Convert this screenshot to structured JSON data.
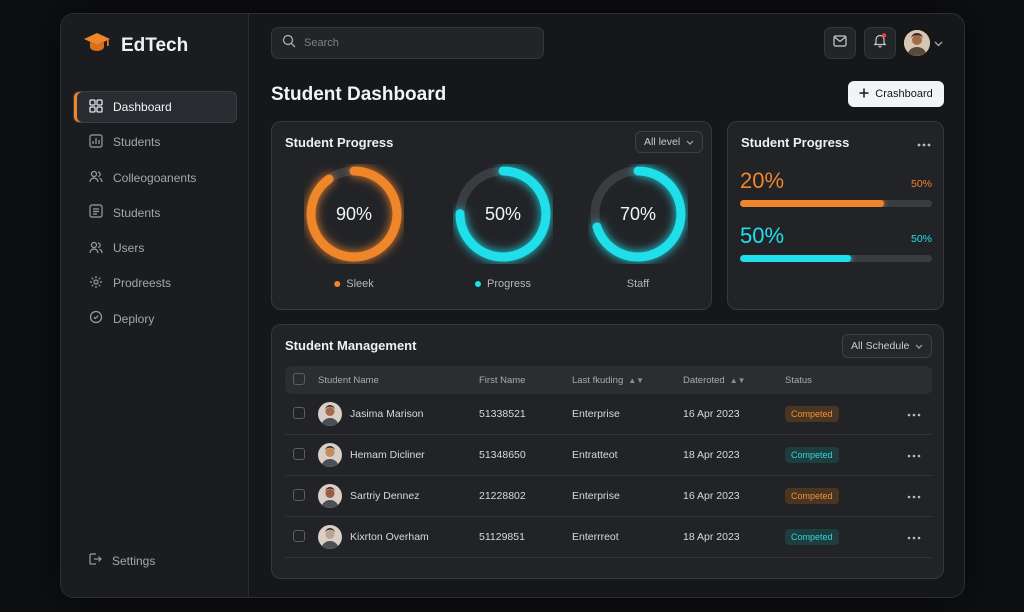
{
  "app": {
    "title": "EdTech"
  },
  "colors": {
    "orange": "#f0862a",
    "cyan": "#1fe0ea",
    "teal": "#3ad3d8",
    "bg": "#161719"
  },
  "sidebar": {
    "items": [
      {
        "label": "Dashboard",
        "icon": "grid-icon",
        "active": true
      },
      {
        "label": "Students",
        "icon": "chart-icon"
      },
      {
        "label": "Colleogoanents",
        "icon": "users-icon"
      },
      {
        "label": "Students",
        "icon": "list-icon"
      },
      {
        "label": "Users",
        "icon": "users-icon"
      },
      {
        "label": "Prodreests",
        "icon": "gear-icon"
      },
      {
        "label": "Deplory",
        "icon": "badge-icon"
      }
    ],
    "settings_label": "Settings"
  },
  "search": {
    "placeholder": "Search"
  },
  "page": {
    "title": "Student Dashboard",
    "primary_button": "Crashboard"
  },
  "progress_card": {
    "title": "Student Progress",
    "filter": "All level",
    "donuts": [
      {
        "value": 90,
        "label": "90%",
        "legend": "Sleek",
        "color": "#f0862a",
        "dot": true
      },
      {
        "value": 75,
        "label": "50%",
        "legend": "Progress",
        "color": "#1fe0ea",
        "dot": true
      },
      {
        "value": 70,
        "label": "70%",
        "legend": "Staff",
        "color": "#1fe0ea",
        "dot": false
      }
    ]
  },
  "progress_bars_card": {
    "title": "Student Progress",
    "bars": [
      {
        "label": "20%",
        "side": "50%",
        "fill": 0.75,
        "color": "#f0862a"
      },
      {
        "label": "50%",
        "side": "50%",
        "fill": 0.58,
        "color": "#1fe0ea"
      }
    ]
  },
  "management": {
    "title": "Student Management",
    "filter": "All Schedule",
    "columns": [
      "Student Name",
      "First Name",
      "Last fkuding",
      "Dateroted",
      "Status"
    ],
    "rows": [
      {
        "name": "Jasima Marison",
        "first": "51338521",
        "last": "Enterprise",
        "date": "16 Apr 2023",
        "status": "Competed",
        "tone": "orange",
        "avatar": "#a86a4c"
      },
      {
        "name": "Hemam Dicliner",
        "first": "51348650",
        "last": "Entratteot",
        "date": "18 Apr 2023",
        "status": "Competed",
        "tone": "teal",
        "avatar": "#c58b5a"
      },
      {
        "name": "Sartriy Dennez",
        "first": "21228802",
        "last": "Enterprise",
        "date": "16 Apr 2023",
        "status": "Competed",
        "tone": "orange",
        "avatar": "#9c5a45"
      },
      {
        "name": "Kixrton Overham",
        "first": "51129851",
        "last": "Enterrreot",
        "date": "18 Apr 2023",
        "status": "Competed",
        "tone": "teal",
        "avatar": "#b9a594"
      }
    ]
  }
}
